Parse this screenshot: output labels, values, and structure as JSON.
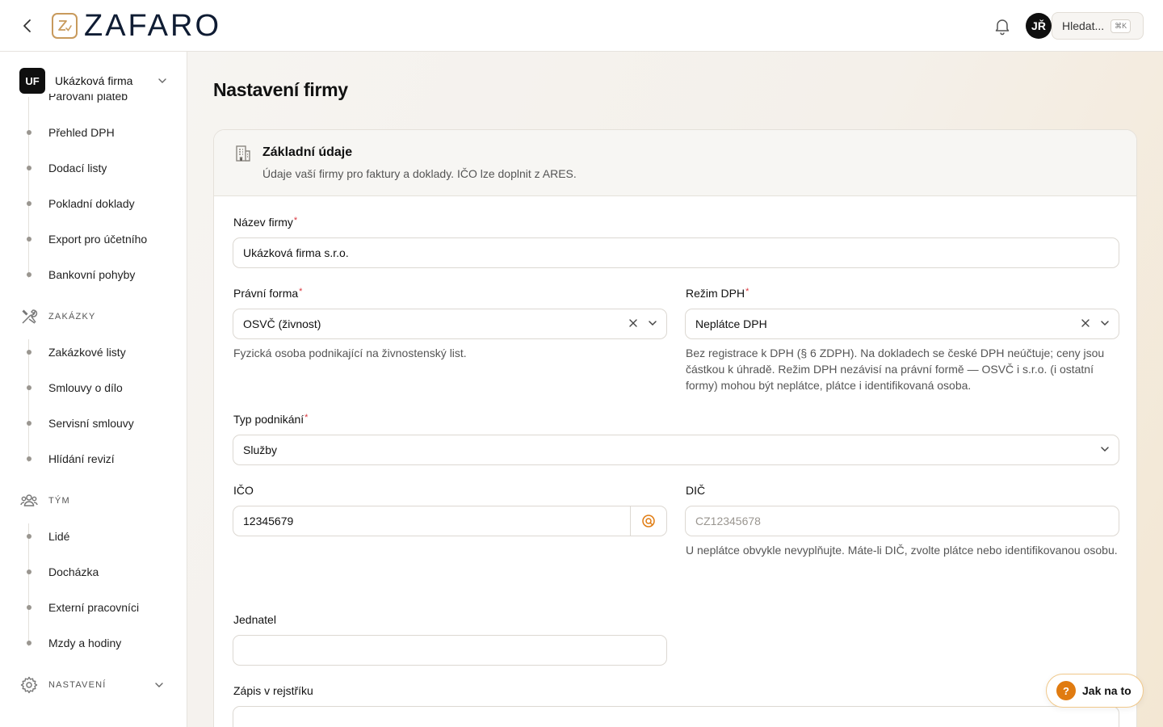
{
  "header": {
    "logo_text": "ZAFARO",
    "avatar_initials": "JŘ",
    "search_label": "Hledat...",
    "search_shortcut": "⌘K"
  },
  "sidebar": {
    "company_initials": "UF",
    "company_name": "Ukázková firma",
    "clipped_item": "Párování plateb",
    "group1_items": [
      "Přehled DPH",
      "Dodací listy",
      "Pokladní doklady",
      "Export pro účetního",
      "Bankovní pohyby"
    ],
    "section_zakazky": "ZAKÁZKY",
    "zakazky_items": [
      "Zakázkové listy",
      "Smlouvy o dílo",
      "Servisní smlouvy",
      "Hlídání revizí"
    ],
    "section_tym": "TÝM",
    "tym_items": [
      "Lidé",
      "Docházka",
      "Externí pracovníci",
      "Mzdy a hodiny"
    ],
    "section_nastaveni": "NASTAVENÍ"
  },
  "main": {
    "page_title": "Nastavení firmy",
    "card": {
      "title": "Základní údaje",
      "subtitle": "Údaje vaší firmy pro faktury a doklady. IČO lze doplnit z ARES."
    },
    "form": {
      "nazev_label": "Název firmy",
      "nazev_value": "Ukázková firma s.r.o.",
      "pravni_label": "Právní forma",
      "pravni_value": "OSVČ (živnost)",
      "pravni_hint": "Fyzická osoba podnikající na živnostenský list.",
      "rezim_label": "Režim DPH",
      "rezim_value": "Neplátce DPH",
      "rezim_hint": "Bez registrace k DPH (§ 6 ZDPH). Na dokladech se české DPH neúčtuje; ceny jsou částkou k úhradě. Režim DPH nezávisí na právní formě — OSVČ i s.r.o. (i ostatní formy) mohou být neplátce, plátce i identifikovaná osoba.",
      "typ_label": "Typ podnikání",
      "typ_value": "Služby",
      "ico_label": "IČO",
      "ico_value": "12345679",
      "dic_label": "DIČ",
      "dic_placeholder": "CZ12345678",
      "dic_hint": "U neplátce obvykle nevyplňujte. Máte-li DIČ, zvolte plátce nebo identifikovanou osobu.",
      "jednatel_label": "Jednatel",
      "zapis_label": "Zápis v rejstříku",
      "required_mark": "*"
    }
  },
  "help": {
    "label": "Jak na to",
    "icon": "?"
  },
  "colors": {
    "accent": "#e07b10",
    "brand_navy": "#0f1c33",
    "logo_gold": "#c89a5c",
    "required": "#d9363e"
  }
}
